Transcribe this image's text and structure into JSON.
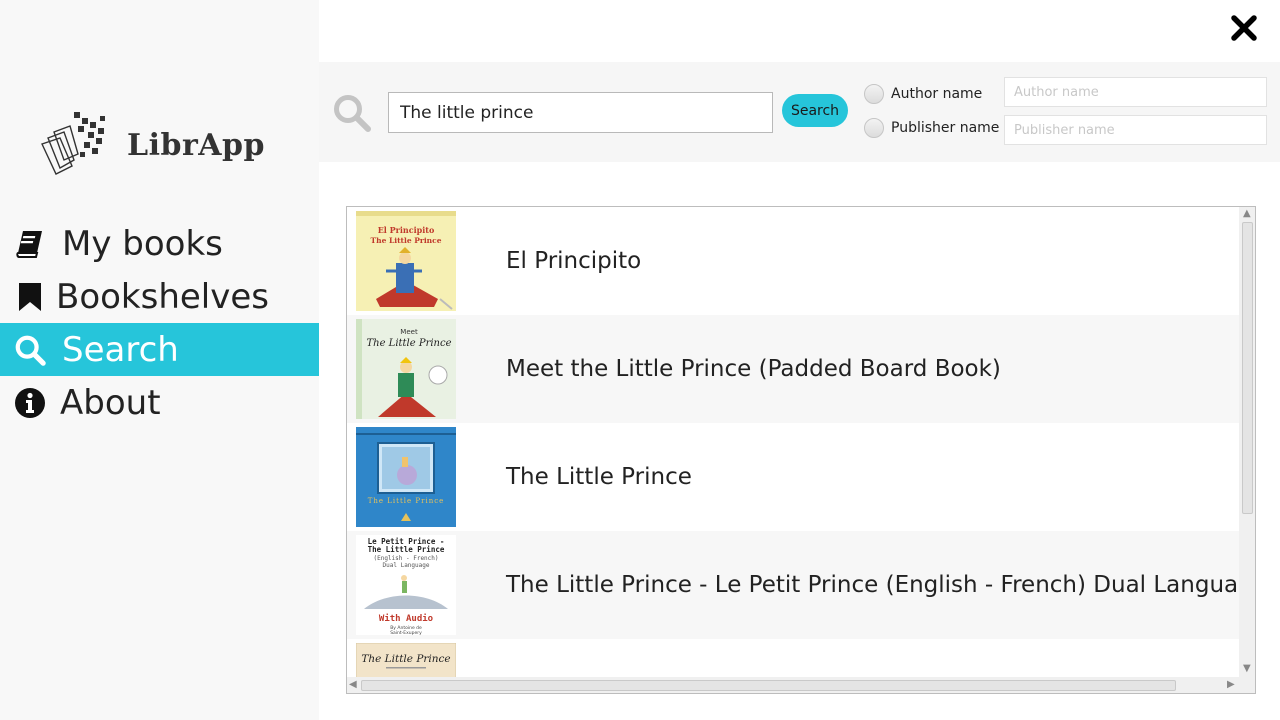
{
  "app": {
    "name": "LibrApp"
  },
  "nav": {
    "items": [
      {
        "label": "My books",
        "icon": "book-icon",
        "active": false
      },
      {
        "label": "Bookshelves",
        "icon": "bookmark-icon",
        "active": false
      },
      {
        "label": "Search",
        "icon": "search-icon",
        "active": true
      },
      {
        "label": "About",
        "icon": "info-icon",
        "active": false
      }
    ]
  },
  "search": {
    "query": "The little prince",
    "button_label": "Search",
    "filters": [
      {
        "label": "Author name",
        "placeholder": "Author name",
        "value": ""
      },
      {
        "label": "Publisher name",
        "placeholder": "Publisher name",
        "value": ""
      }
    ]
  },
  "results": [
    {
      "title": "El Principito",
      "cover_label": "El Principito · The Little Prince"
    },
    {
      "title": "Meet the Little Prince (Padded Board Book)",
      "cover_label": "Meet The Little Prince"
    },
    {
      "title": "The Little Prince",
      "cover_label": "The Little Prince"
    },
    {
      "title": "The Little Prince - Le Petit Prince (English - French) Dual Language Edi",
      "cover_label": "Le Petit Prince - The Little Prince (English - French) Dual Language · With Audio"
    },
    {
      "title": "",
      "cover_label": "The Little Prince"
    }
  ],
  "colors": {
    "accent": "#26c5da",
    "sidebar_bg": "#f8f8f8"
  }
}
